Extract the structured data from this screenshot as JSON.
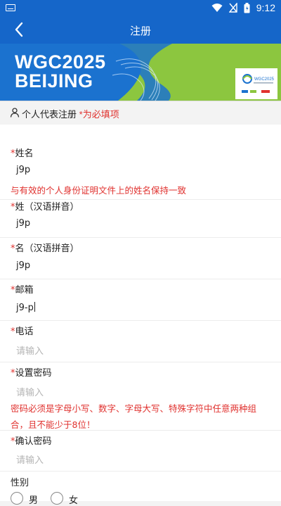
{
  "status_bar": {
    "time": "9:12"
  },
  "app_bar": {
    "title": "注册"
  },
  "banner": {
    "line1": "WGC2025",
    "line2": "BEIJING"
  },
  "section": {
    "title": "个人代表注册",
    "required_note": "*为必填项"
  },
  "form": {
    "name": {
      "star": "*",
      "label": "姓名",
      "value": "j9p",
      "hint": "与有效的个人身份证明文件上的姓名保持一致"
    },
    "surname_pinyin": {
      "star": "*",
      "label": "姓（汉语拼音）",
      "value": "j9p"
    },
    "given_pinyin": {
      "star": "*",
      "label": "名（汉语拼音）",
      "value": "j9p"
    },
    "email": {
      "star": "*",
      "label": "邮箱",
      "value": "j9-p"
    },
    "phone": {
      "star": "*",
      "label": "电话",
      "placeholder": "请输入"
    },
    "password": {
      "star": "*",
      "label": "设置密码",
      "placeholder": "请输入",
      "hint_line1": "密码必须是字母小写、数字、字母大写、特殊字符中任意两种组",
      "hint_line2": "合，且不能少于8位！"
    },
    "confirm_password": {
      "star": "*",
      "label": "确认密码",
      "placeholder": "请输入"
    },
    "gender": {
      "label": "性别",
      "options": [
        "男",
        "女"
      ]
    }
  },
  "colors": {
    "primary": "#1566c9",
    "required": "#e0322f",
    "banner_green": "#8cc63f"
  }
}
